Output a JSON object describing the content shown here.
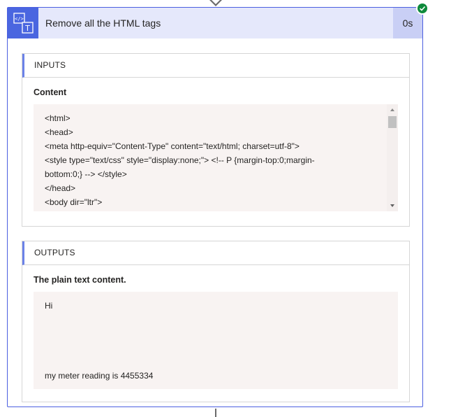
{
  "action": {
    "title": "Remove all the HTML tags",
    "duration": "0s",
    "icon": "html-to-text-icon",
    "status": "success"
  },
  "inputs": {
    "section_title": "INPUTS",
    "field_label": "Content",
    "content_lines": [
      "<html>",
      "<head>",
      "<meta http-equiv=\"Content-Type\" content=\"text/html; charset=utf-8\">",
      "<style type=\"text/css\" style=\"display:none;\"> <!-- P {margin-top:0;margin-",
      "bottom:0;} --> </style>",
      "</head>",
      "<body dir=\"ltr\">"
    ]
  },
  "outputs": {
    "section_title": "OUTPUTS",
    "field_label": "The plain text content.",
    "content_lines": [
      "Hi",
      "my meter reading is 4455334"
    ]
  },
  "colors": {
    "accent": "#4a66e0",
    "header_bg": "#e5e8fb",
    "success": "#0e8a3b",
    "code_bg": "#f8f3f2"
  }
}
